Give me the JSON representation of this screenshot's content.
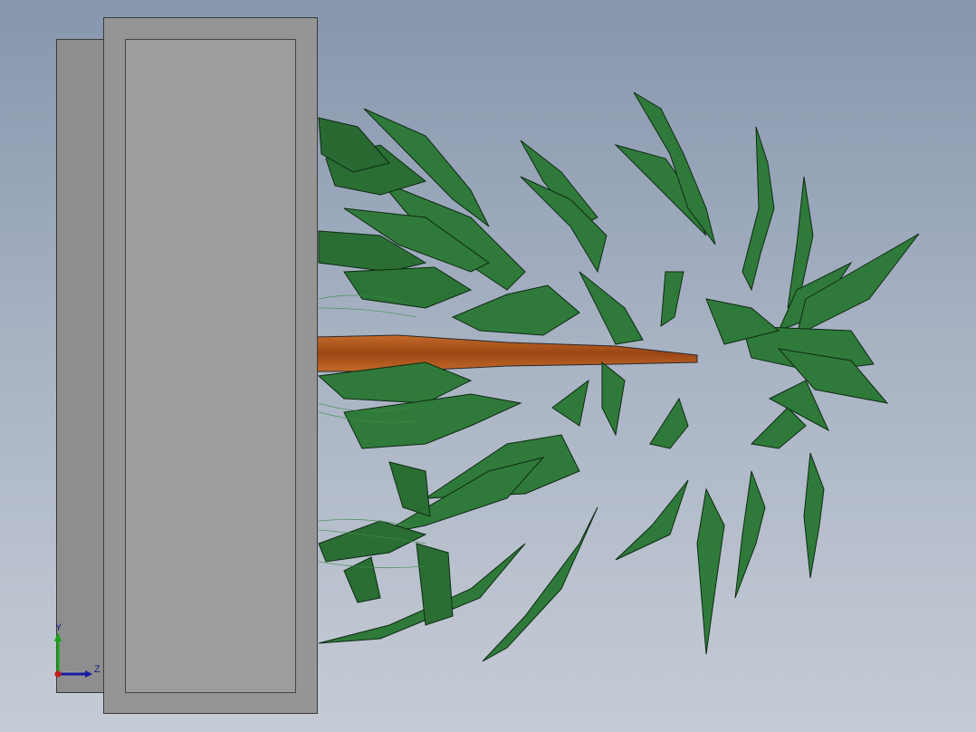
{
  "scene": {
    "background_top": "#8796ad",
    "background_bottom": "#c6ccd6",
    "panel_color": "#959595",
    "leaf_color": "#2f7a3a",
    "leaf_dark": "#1f5a2a",
    "trunk_color": "#b5561f"
  },
  "triad": {
    "y_label": "Y",
    "z_label": "Z",
    "y_color": "#1aa31a",
    "z_color": "#1a1aa3",
    "x_color": "#c81a1a"
  }
}
